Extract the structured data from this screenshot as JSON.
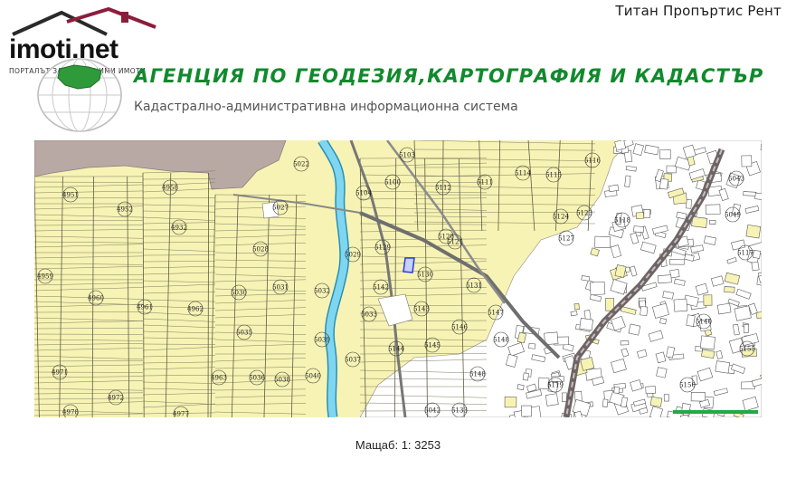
{
  "header": {
    "company_name": "Титан Пропъртис Рент",
    "logo_text": "imoti.net",
    "logo_tagline": "ПОРТАЛЪТ ЗА НЕДВИЖИМИ ИМОТИ"
  },
  "agency": {
    "title": "АГЕНЦИЯ ПО ГЕОДЕЗИЯ,КАРТОГРАФИЯ И КАДАСТЪР",
    "subtitle": "Кадастрално-административна информационна система"
  },
  "map": {
    "scale_label": "Мащаб: 1: 3253",
    "colors": {
      "land": "#f7f3b4",
      "urban": "#ffffff",
      "forest": "#b9a9a4",
      "river": "#5cc8e8",
      "road": "#777777",
      "rail": "#6e6466",
      "highlight": "#3344cc",
      "scale_bar": "#22aa44"
    },
    "parcels": [
      {
        "id": "4951"
      },
      {
        "id": "4952"
      },
      {
        "id": "4958"
      },
      {
        "id": "4959"
      },
      {
        "id": "4960"
      },
      {
        "id": "4961"
      },
      {
        "id": "4962"
      },
      {
        "id": "4971"
      },
      {
        "id": "4972"
      },
      {
        "id": "4978"
      },
      {
        "id": "4977"
      },
      {
        "id": "4963"
      },
      {
        "id": "4932"
      },
      {
        "id": "5022"
      },
      {
        "id": "5027"
      },
      {
        "id": "5028"
      },
      {
        "id": "5030"
      },
      {
        "id": "5031"
      },
      {
        "id": "5032"
      },
      {
        "id": "5035"
      },
      {
        "id": "5033"
      },
      {
        "id": "5036"
      },
      {
        "id": "5038"
      },
      {
        "id": "5039"
      },
      {
        "id": "5040"
      },
      {
        "id": "5037"
      },
      {
        "id": "5029"
      },
      {
        "id": "5103"
      },
      {
        "id": "5104"
      },
      {
        "id": "5100"
      },
      {
        "id": "5112"
      },
      {
        "id": "5111"
      },
      {
        "id": "5114"
      },
      {
        "id": "5115"
      },
      {
        "id": "5116"
      },
      {
        "id": "5124"
      },
      {
        "id": "5123"
      },
      {
        "id": "5121"
      },
      {
        "id": "5127"
      },
      {
        "id": "5128"
      },
      {
        "id": "5129"
      },
      {
        "id": "5130"
      },
      {
        "id": "5131"
      },
      {
        "id": "5142"
      },
      {
        "id": "5143"
      },
      {
        "id": "5144"
      },
      {
        "id": "5145"
      },
      {
        "id": "5146"
      },
      {
        "id": "5147"
      },
      {
        "id": "5148"
      },
      {
        "id": "5133"
      },
      {
        "id": "5042"
      },
      {
        "id": "5043"
      },
      {
        "id": "5049"
      },
      {
        "id": "5117"
      },
      {
        "id": "5118"
      },
      {
        "id": "5119"
      },
      {
        "id": "5140"
      },
      {
        "id": "5155"
      },
      {
        "id": "5150"
      },
      {
        "id": "5148"
      }
    ]
  }
}
